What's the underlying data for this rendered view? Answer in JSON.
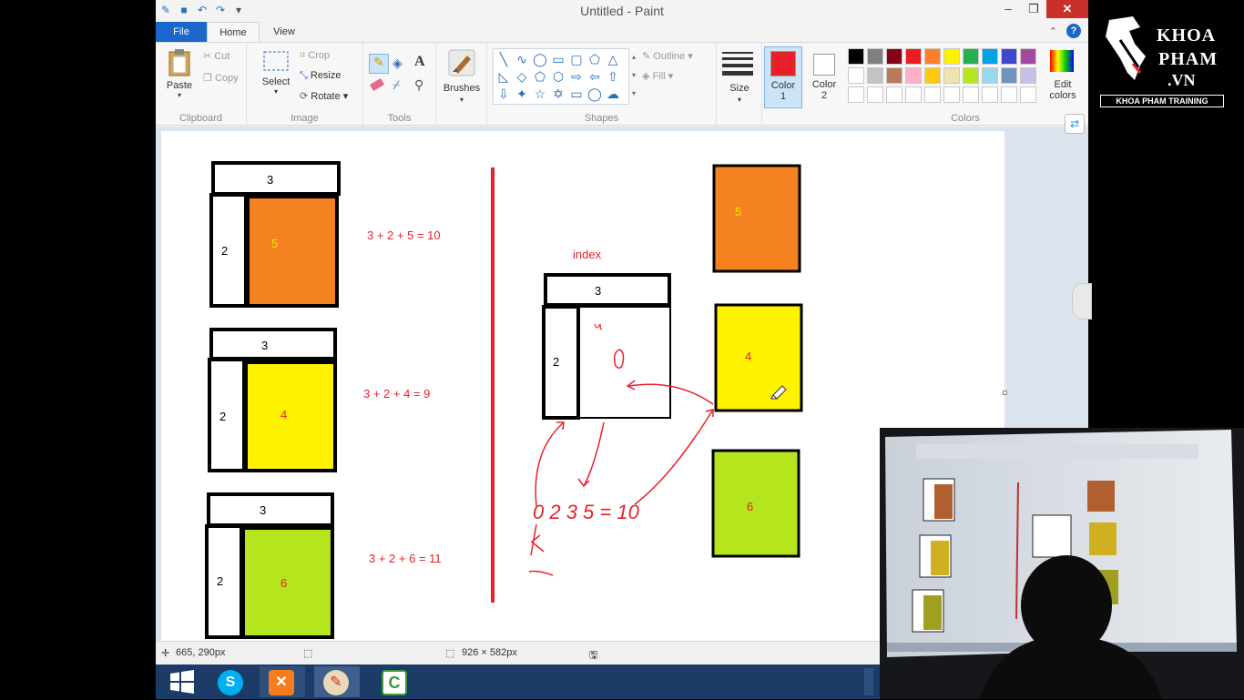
{
  "app": {
    "title": "Untitled - Paint"
  },
  "tabs": [
    {
      "label": "File"
    },
    {
      "label": "Home"
    },
    {
      "label": "View"
    }
  ],
  "ribbon": {
    "clipboard": {
      "label": "Clipboard",
      "paste": "Paste",
      "cut": "Cut",
      "copy": "Copy"
    },
    "image": {
      "label": "Image",
      "select": "Select",
      "crop": "Crop",
      "resize": "Resize",
      "rotate": "Rotate"
    },
    "tools": {
      "label": "Tools"
    },
    "brushes": {
      "label": "Brushes"
    },
    "shapes": {
      "label": "Shapes",
      "outline": "Outline",
      "fill": "Fill"
    },
    "size": {
      "label": "Size"
    },
    "color1": {
      "label": "Color\n1",
      "value": "#e8202a"
    },
    "color2": {
      "label": "Color\n2",
      "value": "#ffffff"
    },
    "colors": {
      "label": "Colors",
      "edit": "Edit\ncolors",
      "palette_row1": [
        "#000000",
        "#7f7f7f",
        "#880015",
        "#ed1c24",
        "#ff7f27",
        "#fff200",
        "#22b14c",
        "#00a2e8",
        "#3f48cc",
        "#a349a4"
      ],
      "palette_row2": [
        "#ffffff",
        "#c3c3c3",
        "#b97a57",
        "#ffaec9",
        "#ffc90e",
        "#efe4b0",
        "#b5e61d",
        "#99d9ea",
        "#7092be",
        "#c8bfe7"
      ]
    }
  },
  "canvas": {
    "groups": [
      {
        "top": "3",
        "left": "2",
        "main": "5",
        "color": "#f58220",
        "main_text_color": "#e8e800",
        "equation": "3 + 2 + 5 = 10"
      },
      {
        "top": "3",
        "left": "2",
        "main": "4",
        "color": "#fff200",
        "main_text_color": "#e8202a",
        "equation": "3 + 2 + 4 = 9"
      },
      {
        "top": "3",
        "left": "2",
        "main": "6",
        "color": "#b5e61d",
        "main_text_color": "#e8202a",
        "equation": "3 + 2 + 6 = 11"
      }
    ],
    "index_label": "index",
    "index_box": {
      "top": "3",
      "left": "2"
    },
    "right_blocks": [
      {
        "value": "5",
        "color": "#f58220",
        "text_color": "#e8e800"
      },
      {
        "value": "4",
        "color": "#fff200",
        "text_color": "#e8202a"
      },
      {
        "value": "6",
        "color": "#b5e61d",
        "text_color": "#e8202a"
      }
    ],
    "handwritten_sum": "0 2 3 5 = 10"
  },
  "status": {
    "cursor_pos": "665, 290px",
    "canvas_size": "926 × 582px"
  },
  "logo": {
    "line1": "KHOA",
    "line2": "PHAM",
    "line3": ".VN",
    "tagline": "KHOA PHAM TRAINING"
  }
}
